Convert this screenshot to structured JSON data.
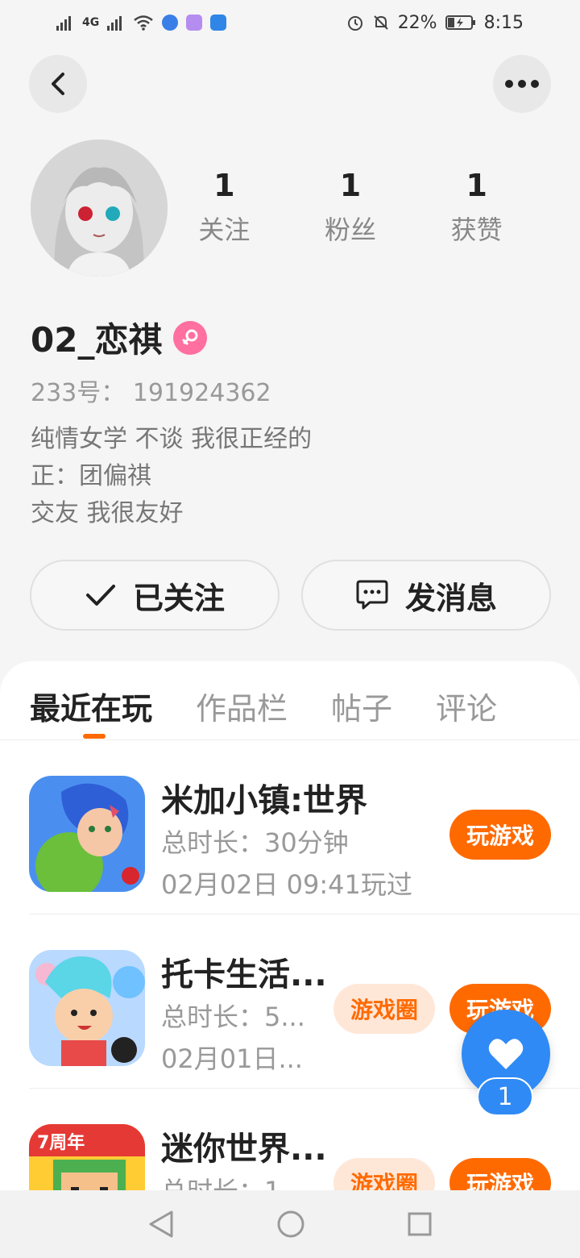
{
  "status_bar": {
    "network_left": "4G",
    "battery": "22%",
    "time": "8:15"
  },
  "profile": {
    "stats": [
      {
        "value": "1",
        "label": "关注"
      },
      {
        "value": "1",
        "label": "粉丝"
      },
      {
        "value": "1",
        "label": "获赞"
      }
    ],
    "username": "02_恋祺",
    "uid": "233号： 191924362",
    "bio": "纯情女学 不谈 我很正经的\n正：团偏祺\n交友  我很友好",
    "follow_label": "已关注",
    "message_label": "发消息"
  },
  "tabs": [
    "最近在玩",
    "作品栏",
    "帖子",
    "评论"
  ],
  "games": [
    {
      "title": "米加小镇:世界",
      "duration": "总时长：30分钟",
      "last_played": "02月02日 09:41玩过",
      "play_label": "玩游戏"
    },
    {
      "title": "托卡生活...",
      "duration": "总时长：5...",
      "last_played": "02月01日...",
      "circle_label": "游戏圈",
      "play_label": "玩游戏"
    },
    {
      "title": "迷你世界...",
      "duration": "总时长：1...",
      "circle_label": "游戏圈",
      "play_label": "玩游戏"
    }
  ],
  "like_fab": {
    "count": "1"
  },
  "colors": {
    "accent": "#ff6a00",
    "like": "#2f8af5",
    "gender": "#ff6fa0"
  }
}
